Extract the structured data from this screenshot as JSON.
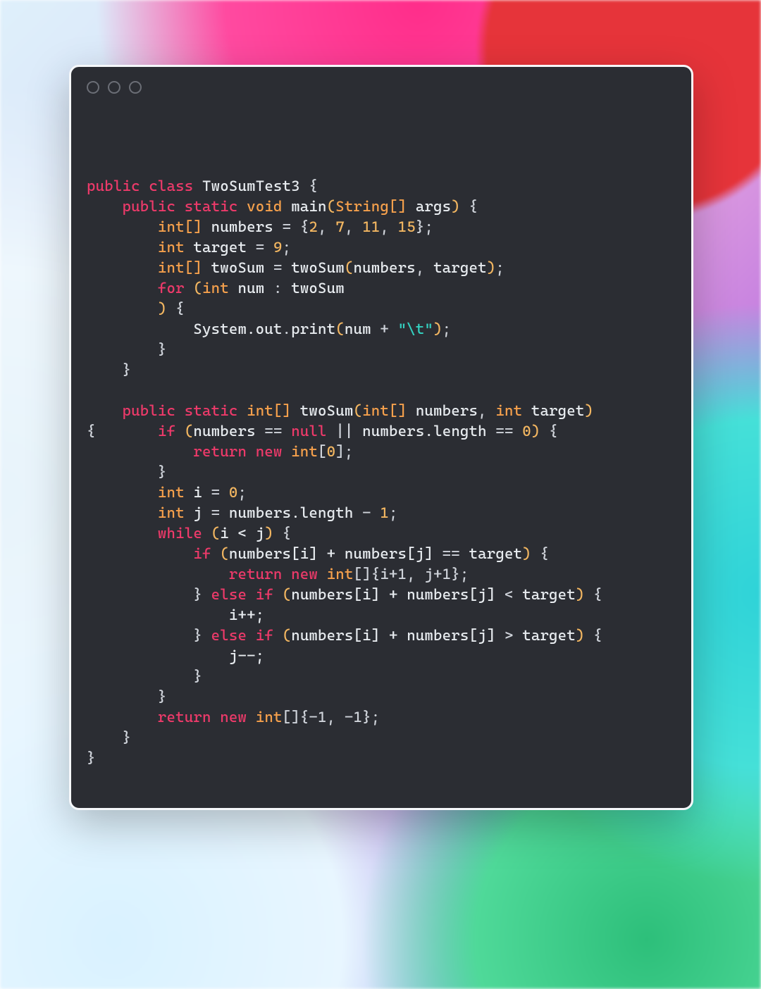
{
  "window": {
    "traffic_light_count": 3
  },
  "code": {
    "class_name": "TwoSumTest3",
    "main_signature": {
      "return": "void",
      "name": "main",
      "param_type": "String[]",
      "param_name": "args"
    },
    "numbers_decl": {
      "type": "int[]",
      "name": "numbers",
      "values": [
        2,
        7,
        11,
        15
      ]
    },
    "target_decl": {
      "type": "int",
      "name": "target",
      "value": 9
    },
    "twosum_var": {
      "type": "int[]",
      "name": "twoSum",
      "call": "twoSum",
      "args": [
        "numbers",
        "target"
      ]
    },
    "for_loop": {
      "elem_type": "int",
      "elem_name": "num",
      "iterable": "twoSum"
    },
    "print_call": {
      "obj": "System.out",
      "method": "print",
      "arg_var": "num",
      "arg_str": "\"\\t\""
    },
    "twoSum_sig": {
      "return": "int[]",
      "name": "twoSum",
      "params": [
        {
          "type": "int[]",
          "name": "numbers"
        },
        {
          "type": "int",
          "name": "target"
        }
      ]
    },
    "guard": {
      "cond_left": "numbers",
      "null_kw": "null",
      "length_expr": "numbers.length",
      "zero": 0,
      "ret_type": "int",
      "ret_size": 0
    },
    "i_decl": {
      "type": "int",
      "name": "i",
      "value": 0
    },
    "j_decl": {
      "type": "int",
      "name": "j",
      "expr_obj": "numbers.length",
      "minus": 1
    },
    "while_cond": "i < j",
    "branch_eq": {
      "lhs": "numbers[i] + numbers[j]",
      "rhs": "target",
      "ret": "{i+1, j+1}"
    },
    "branch_lt": {
      "lhs": "numbers[i] + numbers[j]",
      "rhs": "target",
      "stmt": "i++;"
    },
    "branch_gt": {
      "lhs": "numbers[i] + numbers[j]",
      "rhs": "target",
      "stmt": "j--;"
    },
    "final_return": "{-1, -1}"
  }
}
